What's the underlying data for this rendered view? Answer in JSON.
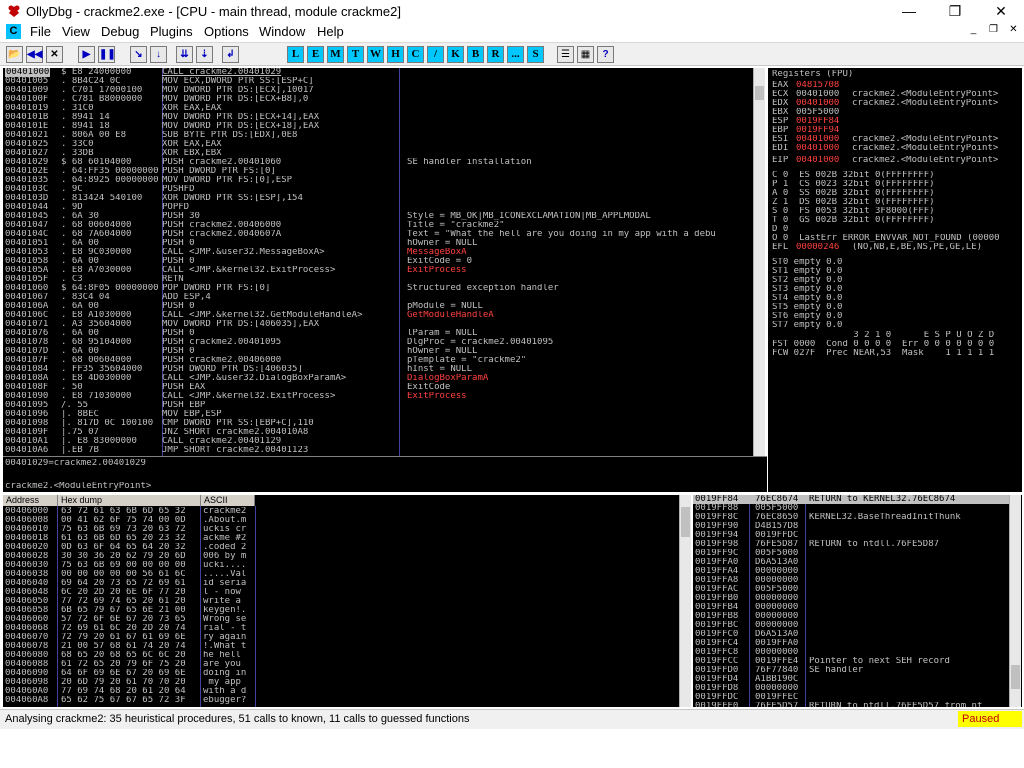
{
  "window": {
    "title": "OllyDbg - crackme2.exe - [CPU - main thread, module crackme2]",
    "minimize": "—",
    "maximize": "❐",
    "close": "✕"
  },
  "menu": {
    "items": [
      "File",
      "View",
      "Debug",
      "Plugins",
      "Options",
      "Window",
      "Help"
    ],
    "mdi": [
      "_",
      "❐",
      "✕"
    ],
    "logo": "C"
  },
  "toolbar": {
    "nav": [
      "📂",
      "◀◀",
      "✕",
      "▶",
      "❚❚",
      "↘",
      "↓",
      "⇊",
      "⇣",
      "↲"
    ],
    "letters": [
      "L",
      "E",
      "M",
      "T",
      "W",
      "H",
      "C",
      "/",
      "K",
      "B",
      "R",
      "...",
      "S"
    ],
    "extra": [
      "☰",
      "▦",
      "?"
    ]
  },
  "disasm": {
    "rows": [
      {
        "a": "00401000",
        "h": "$ E8 24000000",
        "c": "CALL crackme2.00401029",
        "r": ""
      },
      {
        "a": "00401005",
        "h": ". 8B4C24 0C",
        "c": "MOV ECX,DWORD PTR SS:[ESP+C]",
        "r": ""
      },
      {
        "a": "00401009",
        "h": ". C701 17000100",
        "c": "MOV DWORD PTR DS:[ECX],10017",
        "r": ""
      },
      {
        "a": "0040100F",
        "h": ". C781 B8000000",
        "c": "MOV DWORD PTR DS:[ECX+B8],0",
        "r": ""
      },
      {
        "a": "00401019",
        "h": ". 31C0",
        "c": "XOR EAX,EAX",
        "r": ""
      },
      {
        "a": "0040101B",
        "h": ". 8941 14",
        "c": "MOV DWORD PTR DS:[ECX+14],EAX",
        "r": ""
      },
      {
        "a": "0040101E",
        "h": ". 8941 18",
        "c": "MOV DWORD PTR DS:[ECX+18],EAX",
        "r": ""
      },
      {
        "a": "00401021",
        "h": ". 806A 00 E8",
        "c": "SUB BYTE PTR DS:[EDX],0E8",
        "r": ""
      },
      {
        "a": "00401025",
        "h": ". 33C0",
        "c": "XOR EAX,EAX",
        "r": ""
      },
      {
        "a": "00401027",
        "h": ". 33DB",
        "c": "XOR EBX,EBX",
        "r": ""
      },
      {
        "a": "00401029",
        "h": "$ 68 60104000",
        "c": "PUSH crackme2.00401060",
        "r": "SE handler installation"
      },
      {
        "a": "0040102E",
        "h": ". 64:FF35 00000000",
        "c": "PUSH DWORD PTR FS:[0]",
        "r": ""
      },
      {
        "a": "00401035",
        "h": ". 64:8925 00000000",
        "c": "MOV DWORD PTR FS:[0],ESP",
        "r": ""
      },
      {
        "a": "0040103C",
        "h": ". 9C",
        "c": "PUSHFD",
        "r": ""
      },
      {
        "a": "0040103D",
        "h": ". 813424 540100",
        "c": "XOR DWORD PTR SS:[ESP],154",
        "r": ""
      },
      {
        "a": "00401044",
        "h": ". 9D",
        "c": "POPFD",
        "r": ""
      },
      {
        "a": "00401045",
        "h": ". 6A 30",
        "c": "PUSH 30",
        "r": "Style = MB_OK|MB_ICONEXCLAMATION|MB_APPLMODAL"
      },
      {
        "a": "00401047",
        "h": ". 68 00604000",
        "c": "PUSH crackme2.00406000",
        "r": "Title = \"crackme2\""
      },
      {
        "a": "0040104C",
        "h": ". 68 7A604000",
        "c": "PUSH crackme2.0040607A",
        "r": "Text = \"What the hell are you doing in my app with a debu"
      },
      {
        "a": "00401051",
        "h": ". 6A 00",
        "c": "PUSH 0",
        "r": "hOwner = NULL"
      },
      {
        "a": "00401053",
        "h": ". E8 9C030000",
        "c": "CALL <JMP.&user32.MessageBoxA>",
        "r": "MessageBoxA"
      },
      {
        "a": "00401058",
        "h": ". 6A 00",
        "c": "PUSH 0",
        "r": "ExitCode = 0"
      },
      {
        "a": "0040105A",
        "h": ". E8 A7030000",
        "c": "CALL <JMP.&kernel32.ExitProcess>",
        "r": "ExitProcess"
      },
      {
        "a": "0040105F",
        "h": ". C3",
        "c": "RETN",
        "r": ""
      },
      {
        "a": "00401060",
        "h": "$ 64:8F05 00000000",
        "c": "POP DWORD PTR FS:[0]",
        "r": "Structured exception handler"
      },
      {
        "a": "00401067",
        "h": ". 83C4 04",
        "c": "ADD ESP,4",
        "r": ""
      },
      {
        "a": "0040106A",
        "h": ". 6A 00",
        "c": "PUSH 0",
        "r": "pModule = NULL"
      },
      {
        "a": "0040106C",
        "h": ". E8 A1030000",
        "c": "CALL <JMP.&kernel32.GetModuleHandleA>",
        "r": "GetModuleHandleA"
      },
      {
        "a": "00401071",
        "h": ". A3 35604000",
        "c": "MOV DWORD PTR DS:[406035],EAX",
        "r": ""
      },
      {
        "a": "00401076",
        "h": ". 6A 00",
        "c": "PUSH 0",
        "r": "lParam = NULL"
      },
      {
        "a": "00401078",
        "h": ". 68 95104000",
        "c": "PUSH crackme2.00401095",
        "r": "DlgProc = crackme2.00401095"
      },
      {
        "a": "0040107D",
        "h": ". 6A 00",
        "c": "PUSH 0",
        "r": "hOwner = NULL"
      },
      {
        "a": "0040107F",
        "h": ". 68 00604000",
        "c": "PUSH crackme2.00406000",
        "r": "pTemplate = \"crackme2\""
      },
      {
        "a": "00401084",
        "h": ". FF35 35604000",
        "c": "PUSH DWORD PTR DS:[406035]",
        "r": "hInst = NULL"
      },
      {
        "a": "0040108A",
        "h": ". E8 4D030000",
        "c": "CALL <JMP.&user32.DialogBoxParamA>",
        "r": "DialogBoxParamA"
      },
      {
        "a": "0040108F",
        "h": ". 50",
        "c": "PUSH EAX",
        "r": "ExitCode"
      },
      {
        "a": "00401090",
        "h": ". E8 71030000",
        "c": "CALL <JMP.&kernel32.ExitProcess>",
        "r": "ExitProcess"
      },
      {
        "a": "00401095",
        "h": "/. 55",
        "c": "PUSH EBP",
        "r": ""
      },
      {
        "a": "00401096",
        "h": "|. 8BEC",
        "c": "MOV EBP,ESP",
        "r": ""
      },
      {
        "a": "00401098",
        "h": "|. 817D 0C 100100",
        "c": "CMP DWORD PTR SS:[EBP+C],110",
        "r": ""
      },
      {
        "a": "0040109F",
        "h": "|.75 07",
        "c": "JNZ SHORT crackme2.004010A8",
        "r": ""
      },
      {
        "a": "004010A1",
        "h": "|. E8 83000000",
        "c": "CALL crackme2.00401129",
        "r": ""
      },
      {
        "a": "004010A6",
        "h": "|.EB 7B",
        "c": "JMP SHORT crackme2.00401123",
        "r": ""
      }
    ],
    "info1": "00401029=crackme2.00401029",
    "info2": "crackme2.<ModuleEntryPoint>"
  },
  "registers": {
    "header": "Registers (FPU)",
    "gp": [
      {
        "n": "EAX",
        "v": "04815708",
        "c": ""
      },
      {
        "n": "ECX",
        "v": "00401000",
        "c": "crackme2.<ModuleEntryPoint>"
      },
      {
        "n": "EDX",
        "v": "00401000",
        "c": "crackme2.<ModuleEntryPoint>"
      },
      {
        "n": "EBX",
        "v": "005F5000",
        "c": ""
      },
      {
        "n": "ESP",
        "v": "0019FF84",
        "c": ""
      },
      {
        "n": "EBP",
        "v": "0019FF94",
        "c": ""
      },
      {
        "n": "ESI",
        "v": "00401000",
        "c": "crackme2.<ModuleEntryPoint>"
      },
      {
        "n": "EDI",
        "v": "00401000",
        "c": "crackme2.<ModuleEntryPoint>"
      }
    ],
    "eip": {
      "n": "EIP",
      "v": "00401000",
      "c": "crackme2.<ModuleEntryPoint>"
    },
    "flags": [
      "C 0  ES 002B 32bit 0(FFFFFFFF)",
      "P 1  CS 0023 32bit 0(FFFFFFFF)",
      "A 0  SS 002B 32bit 0(FFFFFFFF)",
      "Z 1  DS 002B 32bit 0(FFFFFFFF)",
      "S 0  FS 0053 32bit 3F8000(FFF)",
      "T 0  GS 002B 32bit 0(FFFFFFFF)",
      "D 0",
      "O 0  LastErr ERROR_ENVVAR_NOT_FOUND (00000"
    ],
    "efl": {
      "n": "EFL",
      "v": "00000246",
      "c": "(NO,NB,E,BE,NS,PE,GE,LE)"
    },
    "st": [
      "ST0 empty 0.0",
      "ST1 empty 0.0",
      "ST2 empty 0.0",
      "ST3 empty 0.0",
      "ST4 empty 0.0",
      "ST5 empty 0.0",
      "ST6 empty 0.0",
      "ST7 empty 0.0"
    ],
    "fpu": [
      "               3 2 1 0      E S P U O Z D",
      "FST 0000  Cond 0 0 0 0  Err 0 0 0 0 0 0 0",
      "FCW 027F  Prec NEAR,53  Mask    1 1 1 1 1"
    ]
  },
  "dump": {
    "headers": [
      "Address",
      "Hex dump",
      "ASCII"
    ],
    "rows": [
      {
        "a": "00406000",
        "h": "63 72 61 63 6B 6D 65 32",
        "t": "crackme2"
      },
      {
        "a": "00406008",
        "h": "00 41 62 6F 75 74 00 0D",
        "t": ".About.m"
      },
      {
        "a": "00406010",
        "h": "75 63 6B 69 73 20 63 72",
        "t": "uckis cr"
      },
      {
        "a": "00406018",
        "h": "61 63 6B 6D 65 20 23 32",
        "t": "ackme #2"
      },
      {
        "a": "00406020",
        "h": "0D 63 6F 64 65 64 20 32",
        "t": ".coded 2"
      },
      {
        "a": "00406028",
        "h": "30 30 36 20 62 79 20 6D",
        "t": "006 by m"
      },
      {
        "a": "00406030",
        "h": "75 63 6B 69 00 00 00 00",
        "t": "ucki...."
      },
      {
        "a": "00406038",
        "h": "00 00 00 00 00 56 61 6C",
        "t": ".....Val"
      },
      {
        "a": "00406040",
        "h": "69 64 20 73 65 72 69 61",
        "t": "id seria"
      },
      {
        "a": "00406048",
        "h": "6C 20 2D 20 6E 6F 77 20",
        "t": "l - now "
      },
      {
        "a": "00406050",
        "h": "77 72 69 74 65 20 61 20",
        "t": "write a "
      },
      {
        "a": "00406058",
        "h": "6B 65 79 67 65 6E 21 00",
        "t": "keygen!."
      },
      {
        "a": "00406060",
        "h": "57 72 6F 6E 67 20 73 65",
        "t": "Wrong se"
      },
      {
        "a": "00406068",
        "h": "72 69 61 6C 20 2D 20 74",
        "t": "rial - t"
      },
      {
        "a": "00406070",
        "h": "72 79 20 61 67 61 69 6E",
        "t": "ry again"
      },
      {
        "a": "00406078",
        "h": "21 00 57 68 61 74 20 74",
        "t": "!.What t"
      },
      {
        "a": "00406080",
        "h": "68 65 20 68 65 6C 6C 20",
        "t": "he hell "
      },
      {
        "a": "00406088",
        "h": "61 72 65 20 79 6F 75 20",
        "t": "are you "
      },
      {
        "a": "00406090",
        "h": "64 6F 69 6E 67 20 69 6E",
        "t": "doing in"
      },
      {
        "a": "00406098",
        "h": "20 6D 79 20 61 70 70 20",
        "t": " my app "
      },
      {
        "a": "004060A0",
        "h": "77 69 74 68 20 61 20 64",
        "t": "with a d"
      },
      {
        "a": "004060A8",
        "h": "65 62 75 67 67 65 72 3F",
        "t": "ebugger?"
      }
    ]
  },
  "stack": {
    "rows": [
      {
        "a": "0019FF84",
        "v": "76EC8674",
        "c": "RETURN to KERNEL32.76EC8674"
      },
      {
        "a": "0019FF88",
        "v": "005F5000",
        "c": ""
      },
      {
        "a": "0019FF8C",
        "v": "76EC8650",
        "c": "KERNEL32.BaseThreadInitThunk"
      },
      {
        "a": "0019FF90",
        "v": "D4B157D8",
        "c": ""
      },
      {
        "a": "0019FF94",
        "v": "0019FFDC",
        "c": ""
      },
      {
        "a": "0019FF98",
        "v": "76FE5D87",
        "c": "RETURN to ntdll.76FE5D87"
      },
      {
        "a": "0019FF9C",
        "v": "005F5000",
        "c": ""
      },
      {
        "a": "0019FFA0",
        "v": "D6A513A0",
        "c": ""
      },
      {
        "a": "0019FFA4",
        "v": "00000000",
        "c": ""
      },
      {
        "a": "0019FFA8",
        "v": "00000000",
        "c": ""
      },
      {
        "a": "0019FFAC",
        "v": "005F5000",
        "c": ""
      },
      {
        "a": "0019FFB0",
        "v": "00000000",
        "c": ""
      },
      {
        "a": "0019FFB4",
        "v": "00000000",
        "c": ""
      },
      {
        "a": "0019FFB8",
        "v": "00000000",
        "c": ""
      },
      {
        "a": "0019FFBC",
        "v": "00000000",
        "c": ""
      },
      {
        "a": "0019FFC0",
        "v": "D6A513A0",
        "c": ""
      },
      {
        "a": "0019FFC4",
        "v": "0019FFA0",
        "c": ""
      },
      {
        "a": "0019FFC8",
        "v": "00000000",
        "c": ""
      },
      {
        "a": "0019FFCC",
        "v": "0019FFE4",
        "c": "Pointer to next SEH record"
      },
      {
        "a": "0019FFD0",
        "v": "76F77840",
        "c": "SE handler"
      },
      {
        "a": "0019FFD4",
        "v": "A1BB190C",
        "c": ""
      },
      {
        "a": "0019FFD8",
        "v": "00000000",
        "c": ""
      },
      {
        "a": "0019FFDC",
        "v": "0019FFEC",
        "c": ""
      },
      {
        "a": "0019FFE0",
        "v": "76FE5D57",
        "c": "RETURN to ntdll.76FE5D57 from nt"
      }
    ]
  },
  "status": {
    "message": "Analysing crackme2: 35 heuristical procedures, 51 calls to known, 11 calls to guessed functions",
    "state": "Paused"
  }
}
